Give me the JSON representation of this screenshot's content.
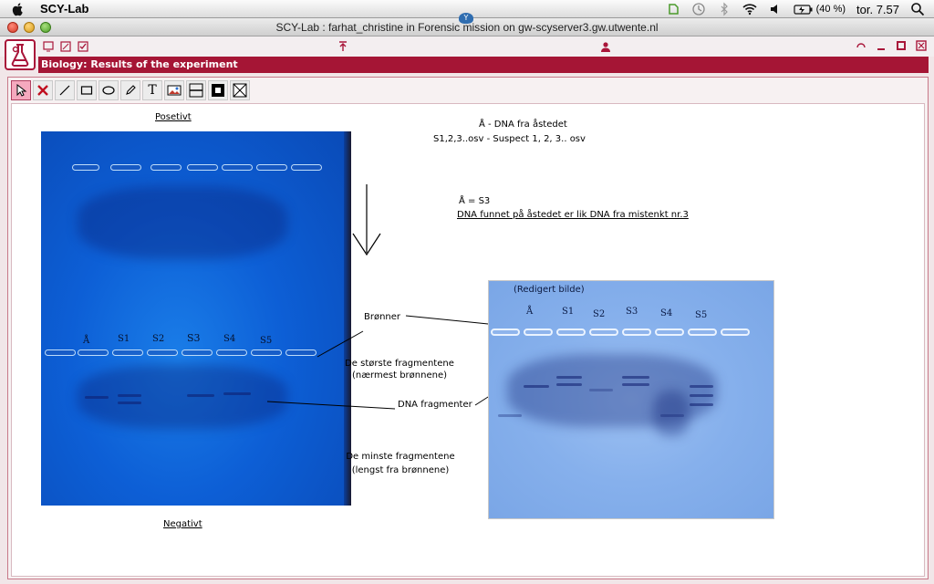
{
  "menubar": {
    "app_name": "SCY-Lab",
    "battery_label": "(40 %)",
    "clock": "tor. 7.57"
  },
  "window": {
    "title": "SCY-Lab : farhat_christine in Forensic mission on gw-scyserver3.gw.utwente.nl"
  },
  "app": {
    "header_title": "Biology: Results of the experiment",
    "accent_color": "#a51535"
  },
  "tools": [
    {
      "name": "select-tool",
      "label": ""
    },
    {
      "name": "delete-tool",
      "label": ""
    },
    {
      "name": "line-tool",
      "label": ""
    },
    {
      "name": "rectangle-tool",
      "label": ""
    },
    {
      "name": "ellipse-tool",
      "label": ""
    },
    {
      "name": "pencil-tool",
      "label": ""
    },
    {
      "name": "text-tool",
      "label": "T"
    },
    {
      "name": "image-tool",
      "label": ""
    },
    {
      "name": "line-style-tool",
      "label": ""
    },
    {
      "name": "fill-tool",
      "label": ""
    },
    {
      "name": "clear-tool",
      "label": ""
    }
  ],
  "canvas": {
    "gel1": {
      "label_top": "Posetivt",
      "label_bottom": "Negativt",
      "lanes": [
        "Å",
        "S1",
        "S2",
        "S3",
        "S4",
        "S5"
      ]
    },
    "gel2": {
      "caption": "(Redigert bilde)",
      "lanes": [
        "Å",
        "S1",
        "S2",
        "S3",
        "S4",
        "S5"
      ]
    },
    "legend": {
      "line1": "Å - DNA fra åstedet",
      "line2": "S1,2,3..osv - Suspect 1, 2, 3.. osv"
    },
    "conclusion": {
      "line1": "Å = S3",
      "line2": "DNA funnet på åstedet er lik DNA fra mistenkt nr.3"
    },
    "annotations": {
      "wells": "Brønner",
      "largest_1": "De største fragmentene",
      "largest_2": "(nærmest brønnene)",
      "fragments": "DNA fragmenter",
      "smallest_1": "De minste fragmentene",
      "smallest_2": "(lengst fra brønnene)"
    }
  }
}
